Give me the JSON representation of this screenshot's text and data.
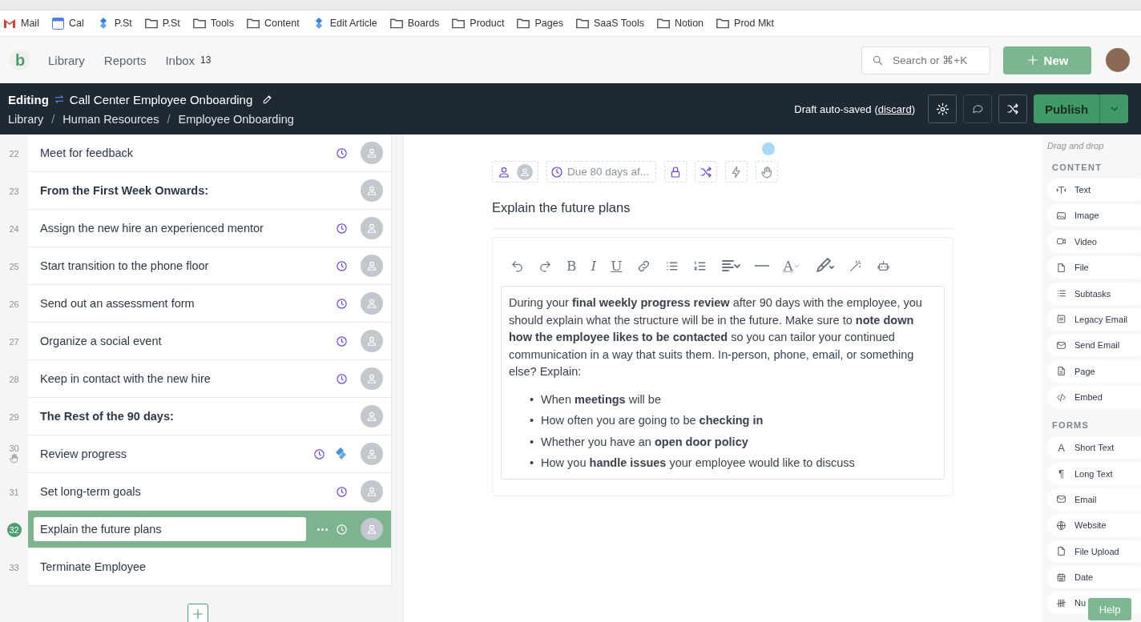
{
  "bookmarks": [
    {
      "label": "Mail",
      "kind": "gmail"
    },
    {
      "label": "Cal",
      "kind": "calendar"
    },
    {
      "label": "P.St",
      "kind": "jira"
    },
    {
      "label": "P.St",
      "kind": "folder"
    },
    {
      "label": "Tools",
      "kind": "folder"
    },
    {
      "label": "Content",
      "kind": "folder"
    },
    {
      "label": "Edit Article",
      "kind": "jira"
    },
    {
      "label": "Boards",
      "kind": "folder"
    },
    {
      "label": "Product",
      "kind": "folder"
    },
    {
      "label": "Pages",
      "kind": "folder"
    },
    {
      "label": "SaaS Tools",
      "kind": "folder"
    },
    {
      "label": "Notion",
      "kind": "folder"
    },
    {
      "label": "Prod Mkt",
      "kind": "folder"
    }
  ],
  "header": {
    "logo": "b",
    "nav": [
      {
        "label": "Library"
      },
      {
        "label": "Reports"
      },
      {
        "label": "Inbox",
        "count": "13"
      }
    ],
    "search_placeholder": "Search or ⌘+K",
    "new_button": "New"
  },
  "edit_bar": {
    "mode": "Editing",
    "title": "Call Center Employee Onboarding",
    "breadcrumbs": [
      "Library",
      "Human Resources",
      "Employee Onboarding"
    ],
    "breadcrumb_separator": "/",
    "status": "Draft auto-saved",
    "paren_open": "(",
    "status_link": "discard",
    "paren_close": ")",
    "publish": "Publish"
  },
  "tasks": [
    {
      "number": "22",
      "title": "Meet for feedback",
      "kind": "task",
      "due": true,
      "integration": false,
      "assignee": true,
      "hand": false,
      "selected": false
    },
    {
      "number": "23",
      "title": "From the First Week Onwards:",
      "kind": "heading",
      "due": false,
      "integration": false,
      "assignee": true,
      "hand": false,
      "selected": false
    },
    {
      "number": "24",
      "title": "Assign the new hire an experienced mentor",
      "kind": "task",
      "due": true,
      "integration": false,
      "assignee": true,
      "hand": false,
      "selected": false
    },
    {
      "number": "25",
      "title": "Start transition to the phone floor",
      "kind": "task",
      "due": true,
      "integration": false,
      "assignee": true,
      "hand": false,
      "selected": false
    },
    {
      "number": "26",
      "title": "Send out an assessment form",
      "kind": "task",
      "due": true,
      "integration": false,
      "assignee": true,
      "hand": false,
      "selected": false
    },
    {
      "number": "27",
      "title": "Organize a social event",
      "kind": "task",
      "due": true,
      "integration": false,
      "assignee": true,
      "hand": false,
      "selected": false
    },
    {
      "number": "28",
      "title": "Keep in contact with the new hire",
      "kind": "task",
      "due": true,
      "integration": false,
      "assignee": true,
      "hand": false,
      "selected": false
    },
    {
      "number": "29",
      "title": "The Rest of the 90 days:",
      "kind": "heading",
      "due": false,
      "integration": false,
      "assignee": true,
      "hand": false,
      "selected": false
    },
    {
      "number": "30",
      "title": "Review progress",
      "kind": "task",
      "due": true,
      "integration": true,
      "assignee": true,
      "hand": true,
      "selected": false
    },
    {
      "number": "31",
      "title": "Set long-term goals",
      "kind": "task",
      "due": true,
      "integration": false,
      "assignee": true,
      "hand": false,
      "selected": false
    },
    {
      "number": "32",
      "title": "Explain the future plans",
      "kind": "task",
      "due": true,
      "integration": false,
      "assignee": true,
      "hand": false,
      "selected": true
    },
    {
      "number": "33",
      "title": "Terminate Employee",
      "kind": "task",
      "due": false,
      "integration": false,
      "assignee": false,
      "hand": false,
      "selected": false
    }
  ],
  "editor": {
    "due_label": "Due 80 days af...",
    "task_title": "Explain the future plans",
    "toolbar": [
      {
        "kind": "undo"
      },
      {
        "kind": "redo"
      },
      {
        "kind": "bold",
        "glyph": "B"
      },
      {
        "kind": "italic",
        "glyph": "I"
      },
      {
        "kind": "underline",
        "glyph": "U"
      },
      {
        "kind": "link"
      },
      {
        "kind": "bullets"
      },
      {
        "kind": "numbered"
      },
      {
        "kind": "align"
      },
      {
        "kind": "rule"
      },
      {
        "kind": "color",
        "glyph": "A"
      },
      {
        "kind": "brush"
      },
      {
        "kind": "magic"
      },
      {
        "kind": "robot"
      }
    ],
    "paragraph": "During your **final weekly progress review** after 90 days with the employee, you should explain what the structure will be in the future. Make sure to **note down how the employee likes to be contacted** so you can tailor your continued communication in a way that suits them. In-person, phone, email, or something else? Explain:",
    "bullet_marker": "•",
    "bullets": [
      "When **meetings** will be",
      "How often you are going to be **checking in**",
      "Whether you have an **open door policy**",
      "How you **handle issues** your employee would like to discuss"
    ]
  },
  "widgets": {
    "hint": "Drag and drop",
    "sections": [
      {
        "title": "CONTENT",
        "items": [
          {
            "label": "Text",
            "kind": "text"
          },
          {
            "label": "Image",
            "kind": "image"
          },
          {
            "label": "Video",
            "kind": "video"
          },
          {
            "label": "File",
            "kind": "file"
          },
          {
            "label": "Subtasks",
            "kind": "bullets"
          },
          {
            "label": "Legacy Email",
            "kind": "legacy"
          },
          {
            "label": "Send Email",
            "kind": "mail"
          },
          {
            "label": "Page",
            "kind": "page"
          },
          {
            "label": "Embed",
            "kind": "embed"
          }
        ]
      },
      {
        "title": "FORMS",
        "items": [
          {
            "label": "Short Text",
            "kind": "glyph",
            "glyph": "A"
          },
          {
            "label": "Long Text",
            "kind": "glyph",
            "glyph": "¶"
          },
          {
            "label": "Email",
            "kind": "mail"
          },
          {
            "label": "Website",
            "kind": "globe"
          },
          {
            "label": "File Upload",
            "kind": "file"
          },
          {
            "label": "Date",
            "kind": "calendar"
          },
          {
            "label": "Nu",
            "kind": "number"
          }
        ]
      }
    ]
  },
  "help": "Help"
}
